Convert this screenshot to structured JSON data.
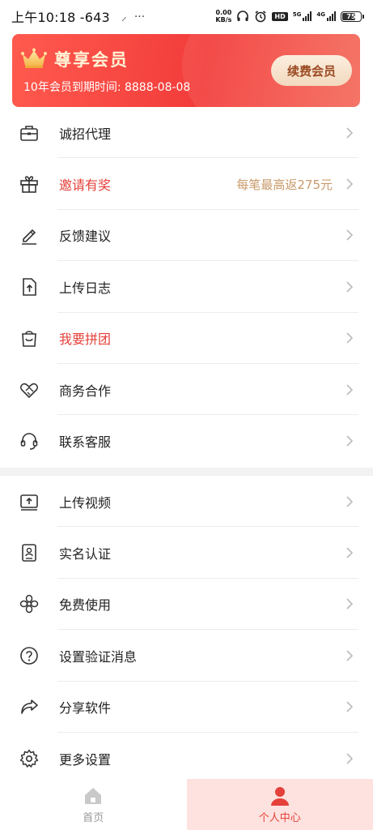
{
  "status_bar": {
    "time": "上午10:18 -643",
    "net_speed_value": "0.00",
    "net_speed_unit": "KB/s",
    "hd": "HD",
    "signal_label_1": "5G",
    "signal_label_2": "4G",
    "battery": "75",
    "battery_level": 0.75
  },
  "vip": {
    "title": "尊享会员",
    "expire_text": "10年会员到期时间: 8888-08-08",
    "renew_label": "续费会员"
  },
  "menu_group_1": [
    {
      "icon": "briefcase-icon",
      "label": "诚招代理",
      "highlight": false,
      "extra": ""
    },
    {
      "icon": "gift-icon",
      "label": "邀请有奖",
      "highlight": true,
      "extra": "每笔最高返275元"
    },
    {
      "icon": "pencil-icon",
      "label": "反馈建议",
      "highlight": false,
      "extra": ""
    },
    {
      "icon": "upload-file-icon",
      "label": "上传日志",
      "highlight": false,
      "extra": ""
    },
    {
      "icon": "shopping-bag-icon",
      "label": "我要拼团",
      "highlight": true,
      "extra": ""
    },
    {
      "icon": "handshake-icon",
      "label": "商务合作",
      "highlight": false,
      "extra": ""
    },
    {
      "icon": "headset-icon",
      "label": "联系客服",
      "highlight": false,
      "extra": ""
    }
  ],
  "menu_group_2": [
    {
      "icon": "upload-video-icon",
      "label": "上传视频",
      "highlight": false,
      "extra": ""
    },
    {
      "icon": "id-card-icon",
      "label": "实名认证",
      "highlight": false,
      "extra": ""
    },
    {
      "icon": "flower-icon",
      "label": "免费使用",
      "highlight": false,
      "extra": ""
    },
    {
      "icon": "question-icon",
      "label": "设置验证消息",
      "highlight": false,
      "extra": ""
    },
    {
      "icon": "share-icon",
      "label": "分享软件",
      "highlight": false,
      "extra": ""
    },
    {
      "icon": "gear-icon",
      "label": "更多设置",
      "highlight": false,
      "extra": ""
    }
  ],
  "bottom_nav": {
    "home_label": "首页",
    "profile_label": "个人中心"
  },
  "colors": {
    "accent": "#e5403a",
    "extra_text": "#c99a6a",
    "banner_start": "#ff5a4e",
    "banner_end": "#f23c3a"
  }
}
